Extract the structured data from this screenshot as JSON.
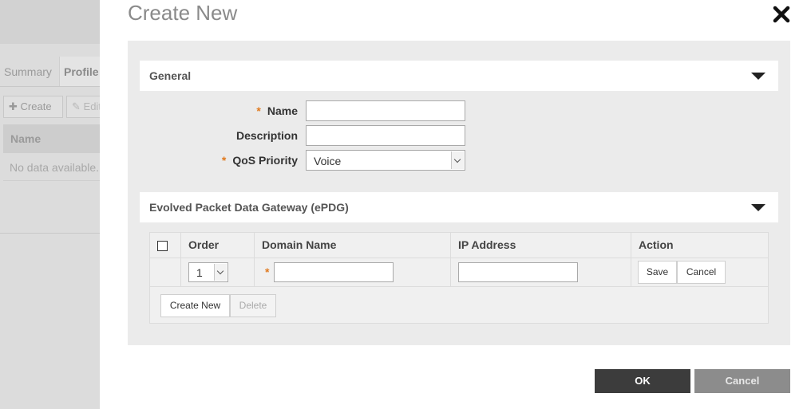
{
  "background": {
    "tabs": [
      "Summary",
      "Profile"
    ],
    "create_label": "Create",
    "edit_label": "Edit",
    "table_header": "Name",
    "empty_text": "No data available."
  },
  "dialog": {
    "title": "Create New",
    "general": {
      "header": "General",
      "name_label": "Name",
      "name_value": "",
      "description_label": "Description",
      "description_value": "",
      "qos_label": "QoS Priority",
      "qos_value": "Voice"
    },
    "epdg": {
      "header": "Evolved Packet Data Gateway (ePDG)",
      "columns": [
        "Order",
        "Domain Name",
        "IP Address",
        "Action"
      ],
      "row": {
        "order": "1",
        "domain_name": "",
        "ip_address": ""
      },
      "save_label": "Save",
      "row_cancel_label": "Cancel",
      "create_new_label": "Create New",
      "delete_label": "Delete"
    },
    "ok_label": "OK",
    "cancel_label": "Cancel"
  },
  "colors": {
    "required_marker": "#e07a1f",
    "ok_button": "#3c3c3c",
    "cancel_button": "#8c8c8c",
    "panel_bg": "#ebebeb"
  }
}
